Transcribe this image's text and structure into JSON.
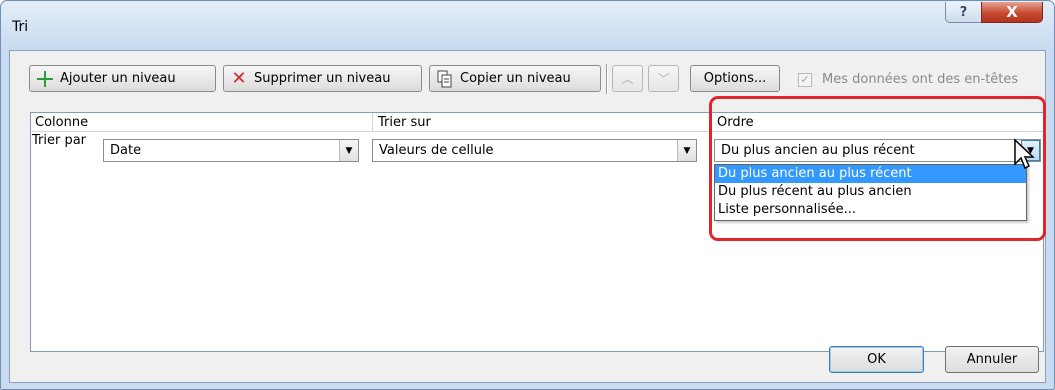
{
  "window": {
    "title": "Tri",
    "help_label": "?",
    "close_label": "X"
  },
  "toolbar": {
    "add_level_label": "Ajouter un niveau",
    "delete_level_label": "Supprimer un niveau",
    "copy_level_label": "Copier un niveau",
    "move_up_label": "^",
    "move_down_label": "v",
    "options_label": "Options...",
    "headers_checkbox_label": "Mes données ont des en-têtes",
    "headers_checked": true
  },
  "grid": {
    "column_header": "Colonne",
    "sort_on_header": "Trier sur",
    "order_header": "Ordre",
    "row": {
      "label": "Trier par",
      "column_value": "Date",
      "sort_on_value": "Valeurs de cellule",
      "order_value": "Du plus ancien au plus récent"
    }
  },
  "order_dropdown": {
    "options": [
      "Du plus ancien au plus récent",
      "Du plus récent au plus ancien",
      "Liste personnalisée..."
    ],
    "selected_index": 0
  },
  "footer": {
    "ok_label": "OK",
    "cancel_label": "Annuler"
  },
  "colors": {
    "highlight": "#e0262b",
    "selection": "#3399ff",
    "frame": "#c8dbf0"
  }
}
